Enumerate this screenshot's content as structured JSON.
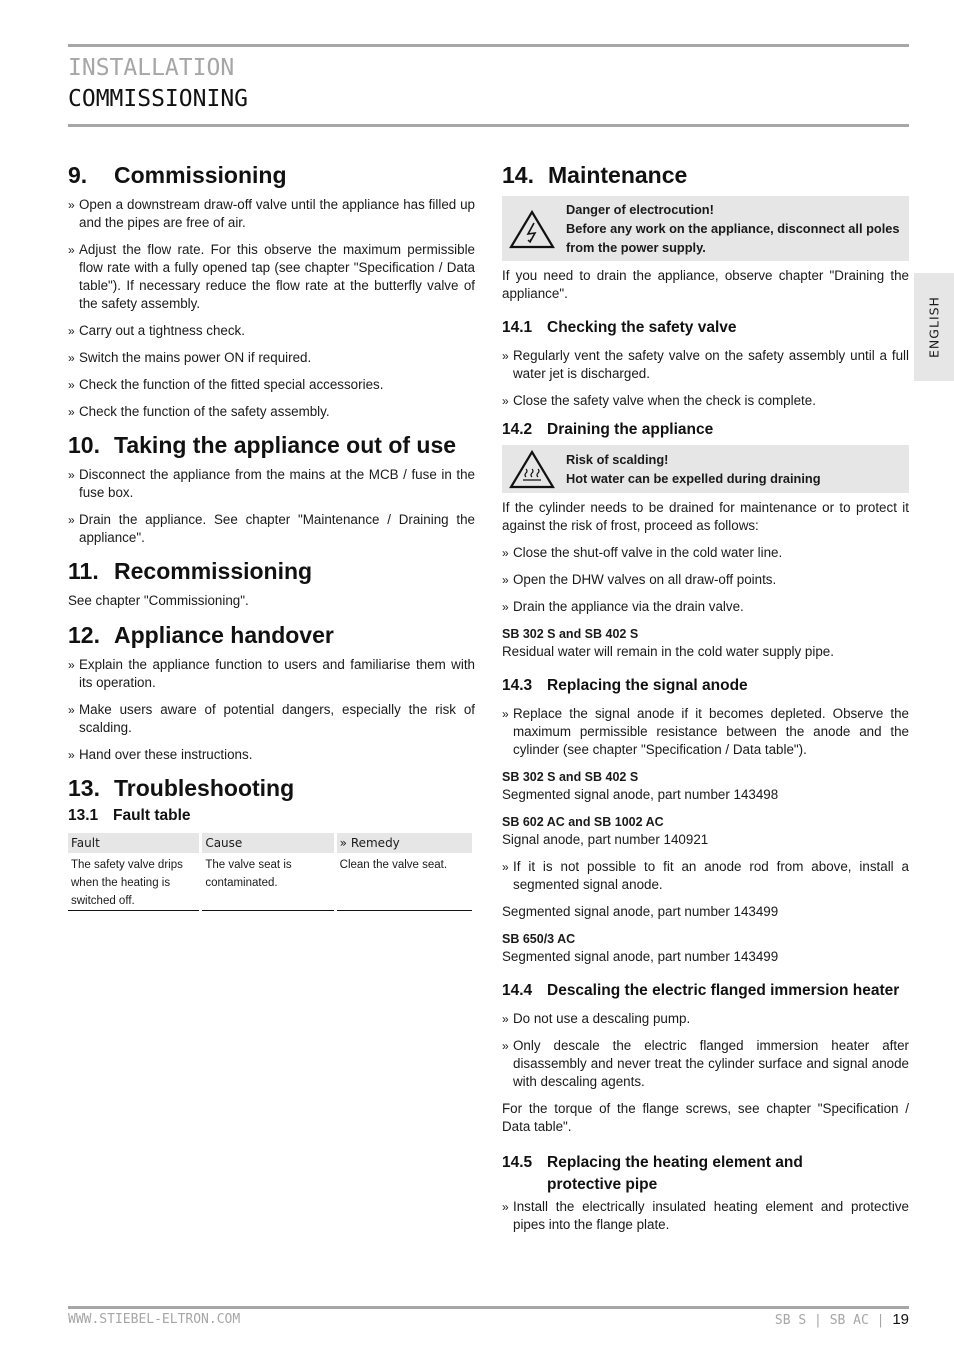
{
  "header": {
    "section": "INSTALLATION",
    "title": "COMMISSIONING"
  },
  "side_tab": "ENGLISH",
  "left": {
    "s9": {
      "num": "9.",
      "title": "Commissioning",
      "items": [
        "Open a downstream draw-off valve until the appliance has filled up and the pipes are free of air.",
        "Adjust the flow rate. For this observe the maximum permissible flow rate with a fully opened tap (see chapter \"Specification / Data table\"). If necessary reduce the flow rate at the butterfly valve of the safety assembly.",
        "Carry out a tightness check.",
        "Switch the mains power ON if required.",
        "Check the function of the fitted special accessories.",
        "Check the function of the safety assembly."
      ]
    },
    "s10": {
      "num": "10.",
      "title": "Taking the appliance out of use",
      "items": [
        "Disconnect the appliance from the mains at the MCB / fuse in the fuse box.",
        "Drain the appliance. See chapter \"Maintenance / Draining the appliance\"."
      ]
    },
    "s11": {
      "num": "11.",
      "title": "Recommissioning",
      "text": "See chapter \"Commissioning\"."
    },
    "s12": {
      "num": "12.",
      "title": "Appliance handover",
      "items": [
        "Explain the appliance function to users and familiarise them with its operation.",
        "Make users aware of potential dangers, especially the risk of scalding.",
        "Hand over these instructions."
      ]
    },
    "s13": {
      "num": "13.",
      "title": "Troubleshooting",
      "sub": {
        "num": "13.1",
        "title": "Fault table"
      },
      "table": {
        "headers": [
          "Fault",
          "Cause",
          "» Remedy"
        ],
        "rows": [
          [
            "The safety valve drips when the heating is switched off.",
            "The valve seat is contaminated.",
            "Clean the valve seat."
          ]
        ]
      }
    }
  },
  "right": {
    "s14": {
      "num": "14.",
      "title": "Maintenance",
      "warning": {
        "icon": "electric-hazard-icon",
        "line1": "Danger of electrocution!",
        "line2": "Before any work on the appliance, disconnect all poles from the power supply."
      },
      "text": "If you need to drain the appliance, observe chapter \"Draining the appliance\"."
    },
    "s14_1": {
      "num": "14.1",
      "title": "Checking the safety valve",
      "items": [
        "Regularly vent the safety valve on the safety assembly until a full water jet is discharged.",
        "Close the safety valve when the check is complete."
      ]
    },
    "s14_2": {
      "num": "14.2",
      "title": "Draining the appliance",
      "warning": {
        "icon": "hot-surface-icon",
        "line1": "Risk of scalding!",
        "line2": "Hot water can be expelled during draining"
      },
      "text": "If the cylinder needs to be drained for maintenance or to protect it against the risk of frost, proceed as follows:",
      "items": [
        "Close the shut-off valve in the cold water line.",
        "Open the DHW valves on all draw-off points.",
        "Drain the appliance via the drain valve."
      ],
      "model": "SB 302 S and SB 402 S",
      "model_text": "Residual water will remain in the cold water supply pipe."
    },
    "s14_3": {
      "num": "14.3",
      "title": "Replacing the signal anode",
      "items": [
        "Replace the signal anode if it becomes depleted. Observe the maximum permissible resistance between the anode and the cylinder (see chapter \"Specification / Data table\")."
      ],
      "model1": "SB 302 S and SB 402 S",
      "model1_text": "Segmented signal anode, part number 143498",
      "model2": "SB 602 AC and SB 1002 AC",
      "model2_text": "Signal anode, part number 140921",
      "items2": [
        "If it is not possible to fit an anode rod from above, install a segmented signal anode."
      ],
      "text2": "Segmented signal anode, part number 143499",
      "model3": "SB 650/3 AC",
      "model3_text": "Segmented signal anode, part number 143499"
    },
    "s14_4": {
      "num": "14.4",
      "title": "Descaling the electric flanged immersion heater",
      "items": [
        "Do not use a descaling pump.",
        "Only descale the electric flanged immersion heater after disassembly and never treat the cylinder surface and signal anode with descaling agents."
      ],
      "text": "For the torque of the flange screws, see chapter \"Specification / Data table\"."
    },
    "s14_5": {
      "num": "14.5",
      "title": "Replacing the heating element and protective pipe",
      "items": [
        "Install the electrically insulated heating element and protective pipes into the flange plate."
      ]
    }
  },
  "footer": {
    "website": "WWW.STIEBEL-ELTRON.COM",
    "models": "SB S | SB AC |",
    "page": "19"
  }
}
